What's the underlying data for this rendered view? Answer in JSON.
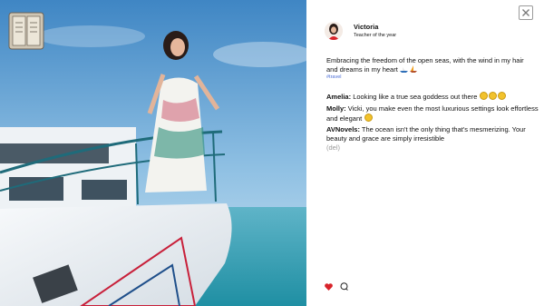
{
  "post": {
    "author": "Victoria",
    "subtitle": "Teacher of the year",
    "caption": "Embracing the freedom of the open seas, with the wind in my hair and dreams in my heart",
    "hashtag": "#travel"
  },
  "comments": [
    {
      "name": "Amelia:",
      "text": "Looking like a true sea goddess out there"
    },
    {
      "name": "Molly:",
      "text": "Vicki, you make even the most luxurious settings look effortless and elegant"
    },
    {
      "name": "AVNovels:",
      "text": "The ocean isn't the only thing that's mesmerizing. Your beauty and grace are simply irresistible"
    }
  ],
  "delete_label": "(del)",
  "icons": {
    "journal": "book-icon",
    "close": "close-icon",
    "like": "heart-icon",
    "comment": "comment-icon"
  },
  "colors": {
    "sky_top": "#4f8fc8",
    "sea": "#2a8fa6",
    "panel": "#ffffff",
    "like": "#d8232a",
    "hashtag": "#4d6fd6"
  }
}
